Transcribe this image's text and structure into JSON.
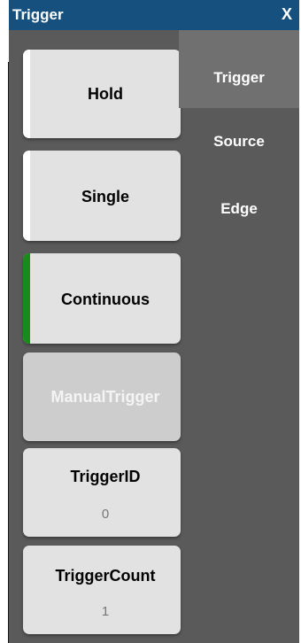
{
  "window": {
    "title": "Trigger",
    "close_label": "X"
  },
  "buttons": [
    {
      "label": "Hold",
      "accent": "#ffffff"
    },
    {
      "label": "Single",
      "accent": "#ffffff"
    },
    {
      "label": "Continuous",
      "accent": "#1a8a1a"
    },
    {
      "label": "ManualTrigger",
      "disabled": true
    },
    {
      "label": "TriggerID",
      "value": "0"
    },
    {
      "label": "TriggerCount",
      "value": "1"
    }
  ],
  "tabs": [
    {
      "label": "Trigger",
      "active": true
    },
    {
      "label": "Source"
    },
    {
      "label": "Edge"
    }
  ],
  "colors": {
    "title_bar": "#16507f",
    "panel": "#5a5a5a",
    "active_tab": "#707070",
    "button": "#e2e2e2"
  }
}
